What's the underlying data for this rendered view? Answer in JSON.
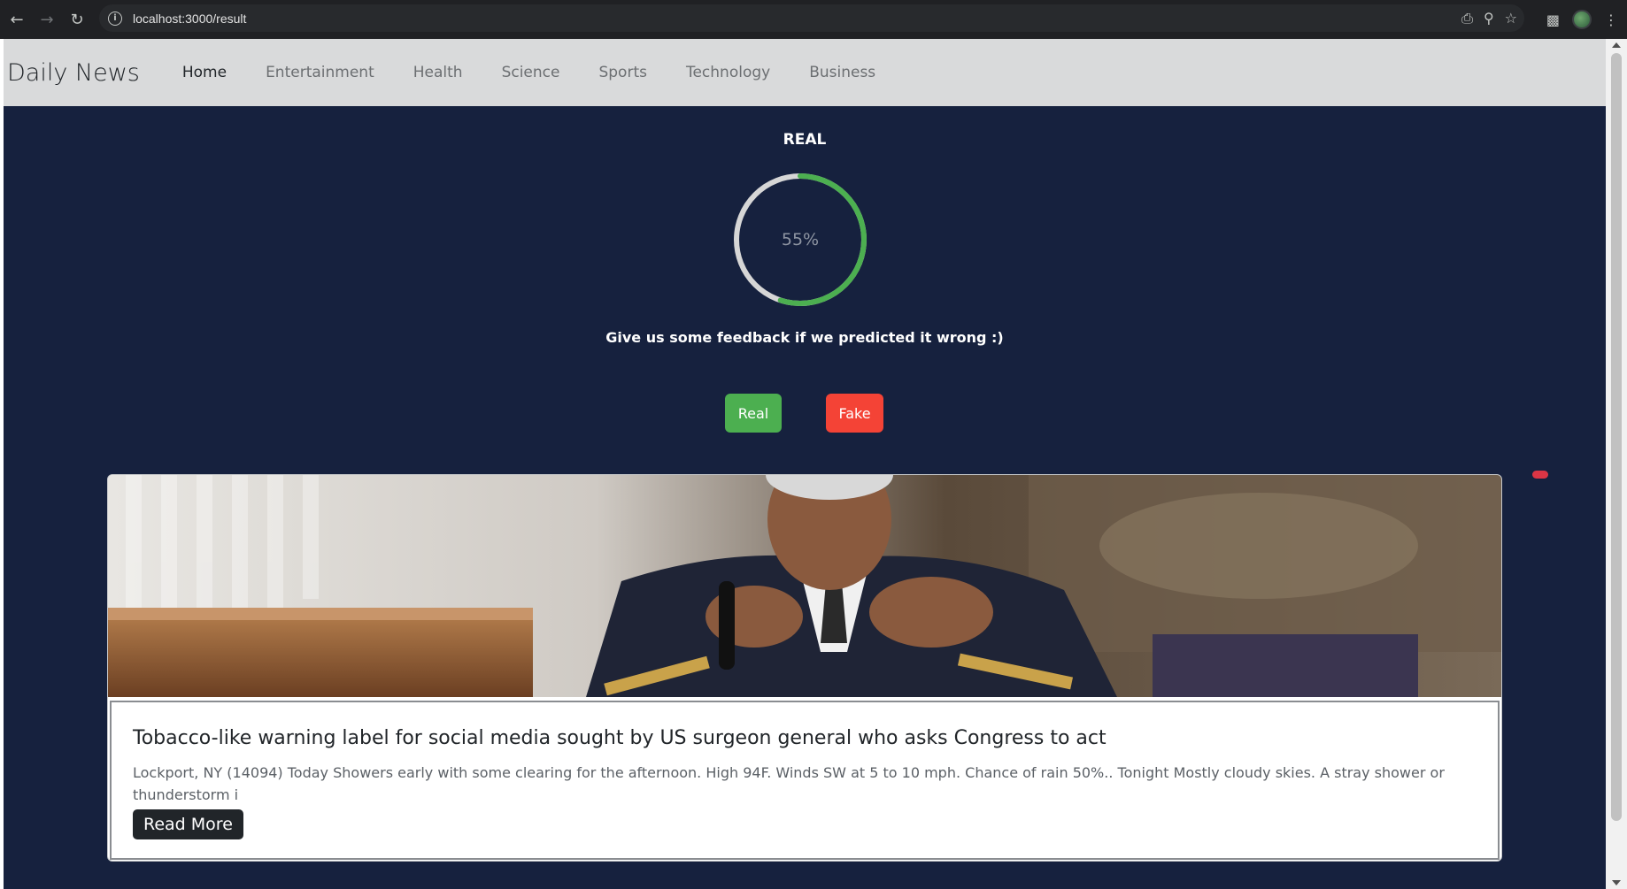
{
  "browser": {
    "url": "localhost:3000/result",
    "back_icon": "arrow-left-icon",
    "forward_icon": "arrow-right-icon",
    "reload_icon": "reload-icon"
  },
  "navbar": {
    "brand": "Daily News",
    "links": [
      "Home",
      "Entertainment",
      "Health",
      "Science",
      "Sports",
      "Technology",
      "Business"
    ],
    "active": "Home"
  },
  "result": {
    "label": "REAL",
    "percent_text": "55%",
    "percent_value": 55,
    "gauge_color": "#4caf50",
    "feedback": "Give us some feedback if we predicted it wrong :)",
    "real_button": "Real",
    "fake_button": "Fake"
  },
  "article": {
    "title": "Tobacco-like warning label for social media sought by US surgeon general who asks Congress to act",
    "description": "Lockport, NY (14094) Today Showers early with some clearing for the afternoon. High 94F. Winds SW at 5 to 10 mph. Chance of rain 50%.. Tonight Mostly cloudy skies. A stray shower or thunderstorm i",
    "read_more": "Read More"
  }
}
